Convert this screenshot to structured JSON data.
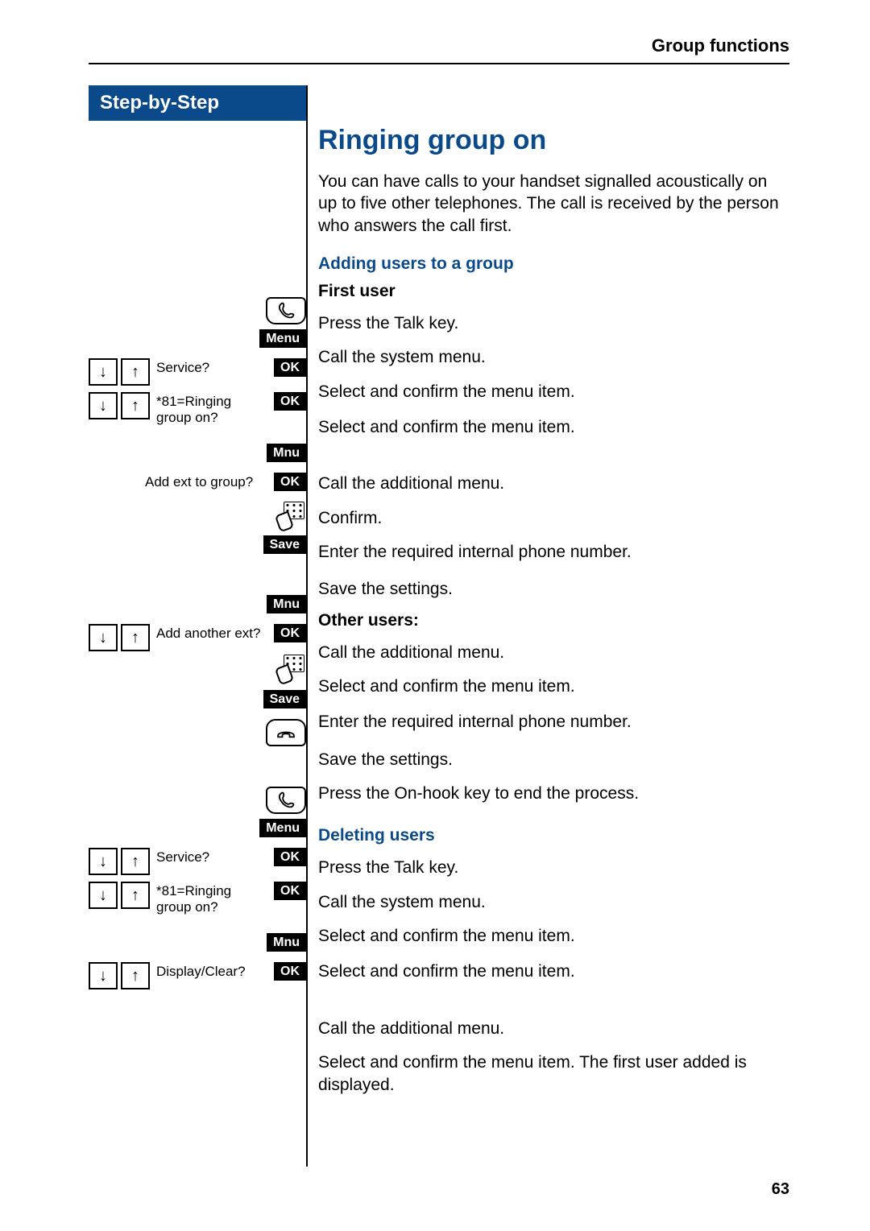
{
  "breadcrumb": "Group functions",
  "page_number": "63",
  "step_header": "Step-by-Step",
  "main_title": "Ringing group on",
  "intro": "You can have calls to your handset signalled acoustically on up to five other telephones. The call is received by the person who answers the call first.",
  "section1_title": "Adding users to a group",
  "first_user_label": "First user",
  "other_users_label": "Other users:",
  "section2_title": "Deleting users",
  "buttons": {
    "menu": "Menu",
    "ok": "OK",
    "mnu": "Mnu",
    "save": "Save"
  },
  "prompts": {
    "service": "Service?",
    "ringing_group": "*81=Ringing group on?",
    "add_ext": "Add ext to group?",
    "add_another": "Add another ext?",
    "display_clear": "Display/Clear?"
  },
  "steps": {
    "press_talk": "Press the Talk key.",
    "call_system_menu": "Call the system menu.",
    "select_confirm": "Select and confirm the menu item.",
    "call_additional": "Call the additional menu.",
    "confirm": "Confirm.",
    "enter_number": "Enter the required internal phone number.",
    "save_settings": "Save the settings.",
    "press_onhook": "Press the On-hook key to end the process.",
    "select_confirm_first": "Select and confirm the menu item. The first user added is displayed."
  }
}
